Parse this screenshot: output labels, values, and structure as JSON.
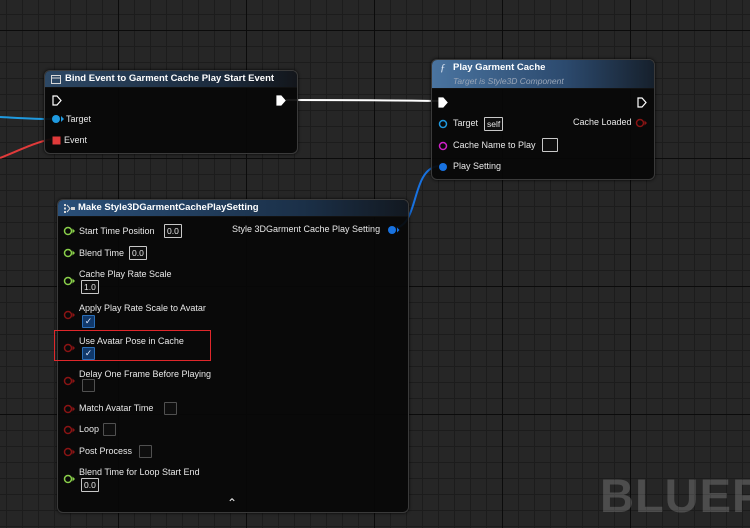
{
  "nodes": {
    "bind_event": {
      "title": "Bind Event to Garment Cache Play Start Event",
      "pins": {
        "target": "Target",
        "event": "Event"
      }
    },
    "play_cache": {
      "title": "Play Garment Cache",
      "subtitle": "Target is Style3D Component",
      "pins": {
        "target": "Target",
        "target_default": "self",
        "cache_loaded": "Cache Loaded",
        "cache_name": "Cache Name to Play",
        "play_setting": "Play Setting"
      }
    },
    "make_setting": {
      "title": "Make Style3DGarmentCachePlaySetting",
      "output": "Style 3DGarment Cache Play Setting",
      "pins": [
        {
          "label": "Start Time Position",
          "value": "0.0",
          "color": "#8ad04a"
        },
        {
          "label": "Blend Time",
          "value": "0.0",
          "color": "#8ad04a"
        },
        {
          "label": "Cache Play Rate Scale",
          "value": "1.0",
          "color": "#8ad04a"
        },
        {
          "label": "Apply Play Rate Scale to Avatar",
          "checked": true,
          "color": "#8a1414"
        },
        {
          "label": "Use Avatar Pose in Cache",
          "checked": true,
          "color": "#8a1414"
        },
        {
          "label": "Delay One Frame Before Playing",
          "checked": false,
          "color": "#8a1414"
        },
        {
          "label": "Match Avatar Time",
          "checked": false,
          "color": "#8a1414"
        },
        {
          "label": "Loop",
          "checked": false,
          "color": "#8a1414"
        },
        {
          "label": "Post Process",
          "checked": false,
          "color": "#8a1414"
        },
        {
          "label": "Blend Time for Loop Start End",
          "value": "0.0",
          "color": "#8ad04a"
        }
      ]
    }
  },
  "colors": {
    "object_pin": "#1f9ae0",
    "delegate_pin": "#e03a3a",
    "string_pin": "#d020c8",
    "struct_pin": "#1872e0",
    "float_pin": "#8ad04a",
    "bool_pin": "#8a1414",
    "highlight": "#e0272b"
  },
  "watermark": "BLUEPR",
  "checkmark_glyph": "✓",
  "collapse_glyph": "⌃"
}
